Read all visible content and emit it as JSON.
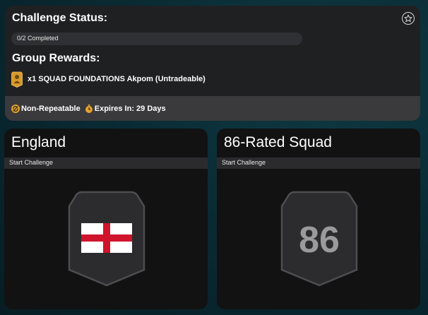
{
  "status_panel": {
    "title": "Challenge Status:",
    "progress_text": "0/2 Completed",
    "progress_fraction": 0,
    "rewards_title": "Group Rewards:",
    "reward_text": "x1 SQUAD FOUNDATIONS Akpom (Untradeable)",
    "reward_icon": "player-card-icon",
    "favorite_icon": "star-icon"
  },
  "footer": {
    "repeat_icon": "repeat-icon",
    "repeat_text": "Non-Repeatable",
    "timer_icon": "stopwatch-icon",
    "expires_text": "Expires In: 29 Days"
  },
  "cards": [
    {
      "title": "England",
      "start_label": "Start Challenge",
      "badge_icon": "england-flag-icon"
    },
    {
      "title": "86-Rated Squad",
      "start_label": "Start Challenge",
      "badge_text": "86"
    }
  ],
  "colors": {
    "accent_gold": "#e6a32e",
    "panel_bg": "#1f2022",
    "card_bg": "#121213",
    "flag_red": "#cf142b"
  }
}
